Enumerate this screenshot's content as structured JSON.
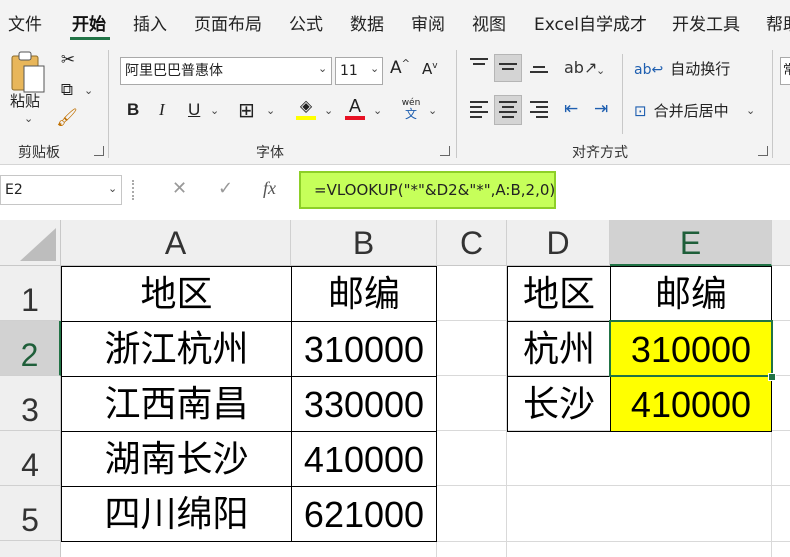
{
  "menu": {
    "tabs": [
      "文件",
      "开始",
      "插入",
      "页面布局",
      "公式",
      "数据",
      "审阅",
      "视图",
      "Excel自学成才",
      "开发工具",
      "帮助"
    ]
  },
  "ribbon": {
    "clipboard": {
      "paste_label": "粘贴",
      "group_label": "剪贴板"
    },
    "font": {
      "font_name": "阿里巴巴普惠体",
      "font_size": "11",
      "bold": "B",
      "italic": "I",
      "underline": "U",
      "phonetic_top": "wén",
      "phonetic_bottom": "文",
      "group_label": "字体"
    },
    "alignment": {
      "wrap_text": "自动换行",
      "merge_center": "合并后居中",
      "group_label": "对齐方式"
    },
    "number": {
      "format_partial": "常"
    }
  },
  "formula_bar": {
    "name_box": "E2",
    "formula": "=VLOOKUP(\"*\"&D2&\"*\",A:B,2,0)"
  },
  "sheet": {
    "columns": [
      "A",
      "B",
      "C",
      "D",
      "E"
    ],
    "rows": [
      "1",
      "2",
      "3",
      "4",
      "5"
    ],
    "table1": {
      "header": [
        "地区",
        "邮编"
      ],
      "rows": [
        [
          "浙江杭州",
          "310000"
        ],
        [
          "江西南昌",
          "330000"
        ],
        [
          "湖南长沙",
          "410000"
        ],
        [
          "四川绵阳",
          "621000"
        ]
      ]
    },
    "table2": {
      "header": [
        "地区",
        "邮编"
      ],
      "rows": [
        [
          "杭州",
          "310000"
        ],
        [
          "长沙",
          "410000"
        ]
      ]
    },
    "active_cell": "E2",
    "highlight_color": "#ffff00",
    "accent_color": "#217346"
  }
}
